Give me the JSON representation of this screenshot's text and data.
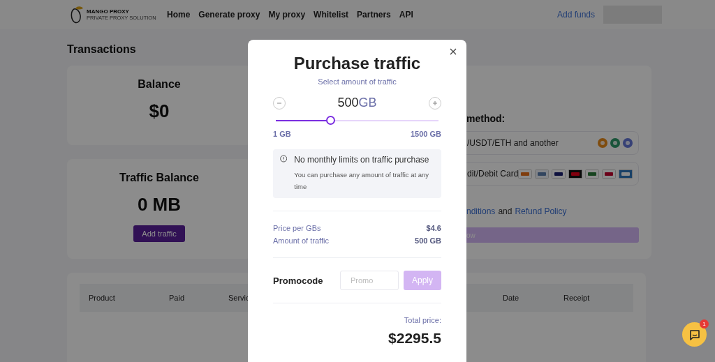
{
  "header": {
    "logo": {
      "name": "MANGO PROXY",
      "tagline": "PRIVATE PROXY SOLUTION"
    },
    "nav": [
      "Home",
      "Generate proxy",
      "My proxy",
      "Whitelist",
      "Partners",
      "API"
    ],
    "add_funds": "Add funds"
  },
  "page_title": "Transactions",
  "balance_card": {
    "title": "Balance",
    "value": "$0"
  },
  "traffic_card": {
    "title": "Traffic Balance",
    "value": "0 MB",
    "button": "Add traffic"
  },
  "payment_card": {
    "heading": "method:",
    "options": [
      {
        "label": "/USDT/ETH and another",
        "kind": "crypto"
      },
      {
        "label": "dit/Debit Card",
        "kind": "card"
      }
    ],
    "terms": [
      {
        "text": "nditions",
        "kind": "link"
      },
      {
        "text": "and",
        "kind": "plain"
      },
      {
        "text": "Refund Policy",
        "kind": "link"
      }
    ],
    "button": "ow"
  },
  "table": {
    "columns": [
      "Product",
      "Paid",
      "Servic",
      "Date",
      "Receipt"
    ]
  },
  "modal": {
    "title": "Purchase traffic",
    "subtitle": "Select amount of traffic",
    "amount": {
      "value": "500",
      "unit": "GB"
    },
    "slider": {
      "level": 0.333,
      "min_label": "1 GB",
      "max_label": "1500 GB"
    },
    "info": {
      "title": "No monthly limits on traffic purchase",
      "text": "You can purchase any amount of traffic at any time"
    },
    "summary": [
      {
        "label": "Price per GBs",
        "value": "$4.6"
      },
      {
        "label": "Amount of traffic",
        "value": "500 GB"
      }
    ],
    "promo": {
      "label": "Promocode",
      "placeholder": "Promo",
      "button": "Apply",
      "disabled": true
    },
    "total": {
      "label": "Total price:",
      "value": "$2295.5"
    }
  },
  "chat": {
    "badge": "1"
  }
}
